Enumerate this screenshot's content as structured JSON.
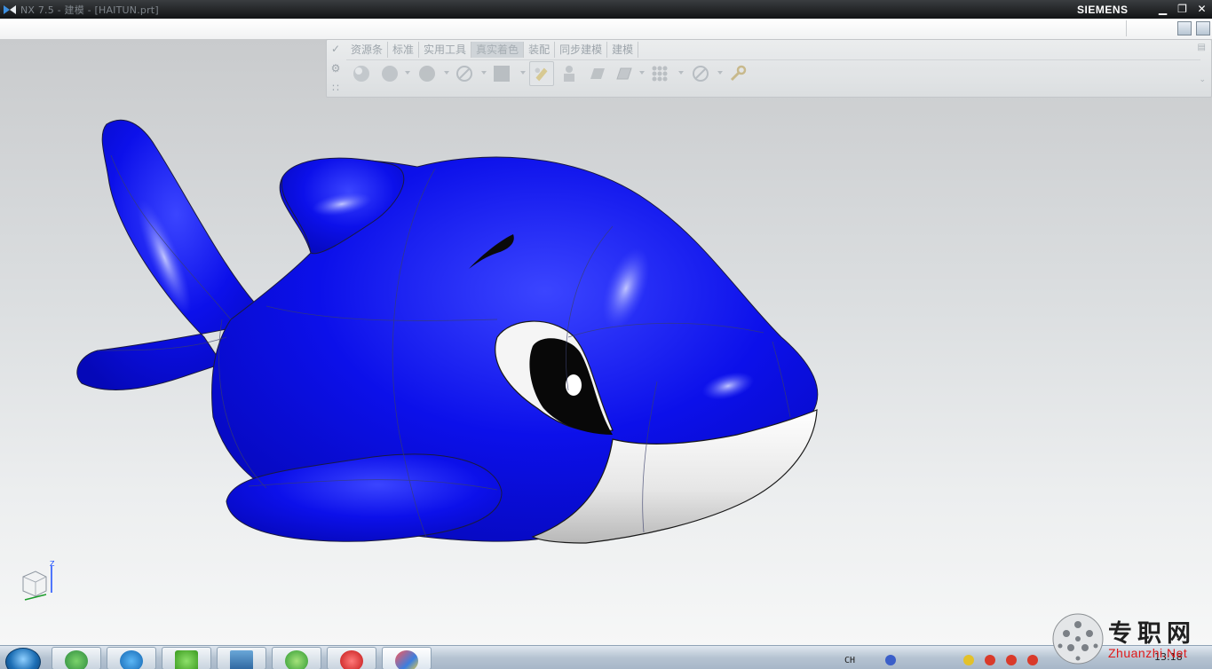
{
  "window": {
    "title": "NX 7.5 - 建模 - [HAITUN.prt]",
    "brand": "SIEMENS",
    "minimize_icon": "minimize-icon",
    "maximize_icon": "restore-icon",
    "close_icon": "close-icon"
  },
  "ribbon": {
    "tabs": [
      {
        "label": "资源条"
      },
      {
        "label": "标准"
      },
      {
        "label": "实用工具"
      },
      {
        "label": "真实着色"
      },
      {
        "label": "装配"
      },
      {
        "label": "同步建模"
      },
      {
        "label": "建模"
      }
    ],
    "active_tab": "真实着色",
    "tools": [
      "sphere-shade-icon",
      "sphere-icon",
      "sphere-flat-icon",
      "no-symbol-icon",
      "square-shade-icon",
      "pencil-highlight-icon",
      "figure-icon",
      "plane-icon",
      "plane-grid-icon",
      "dots-grid-icon",
      "no-symbol-icon",
      "wrench-icon"
    ]
  },
  "viewport": {
    "model": "dolphin",
    "model_color": "#0a0fe8",
    "belly_color": "#f1f1f1",
    "background_top": "#c9cbcd",
    "background_bottom": "#f6f7f7",
    "triad_label": "Z"
  },
  "taskbar": {
    "apps": [
      "start-orb-icon",
      "explorer-icon",
      "kugou-icon",
      "iqiyi-icon",
      "media-icon",
      "browser-icon",
      "player-icon",
      "nx-icon"
    ],
    "tray_lang": "CH",
    "clock": "13:18"
  },
  "watermark": {
    "cn": "专职网",
    "en": "Zhuanzhi.Net"
  }
}
